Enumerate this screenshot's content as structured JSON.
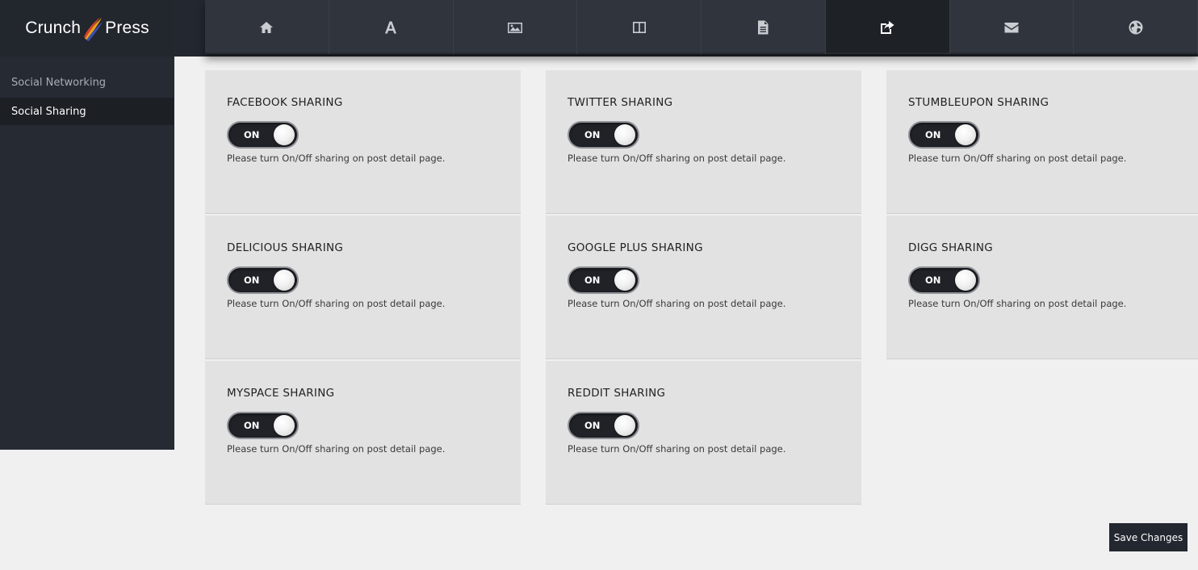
{
  "app": {
    "logo_left": "Crunch",
    "logo_right": "Press"
  },
  "nav": {
    "tabs": [
      {
        "icon": "home-icon",
        "active": false
      },
      {
        "icon": "typography-icon",
        "active": false
      },
      {
        "icon": "image-icon",
        "active": false
      },
      {
        "icon": "layout-columns-icon",
        "active": false
      },
      {
        "icon": "document-icon",
        "active": false
      },
      {
        "icon": "share-icon",
        "active": true
      },
      {
        "icon": "envelope-icon",
        "active": false
      },
      {
        "icon": "globe-icon",
        "active": false
      }
    ]
  },
  "sidebar": {
    "items": [
      {
        "label": "Social Networking",
        "active": false
      },
      {
        "label": "Social Sharing",
        "active": true
      }
    ]
  },
  "cards": [
    {
      "title": "FACEBOOK SHARING",
      "toggle": "ON",
      "description": "Please turn On/Off sharing on post detail page."
    },
    {
      "title": "TWITTER SHARING",
      "toggle": "ON",
      "description": "Please turn On/Off sharing on post detail page."
    },
    {
      "title": "STUMBLEUPON SHARING",
      "toggle": "ON",
      "description": "Please turn On/Off sharing on post detail page."
    },
    {
      "title": "DELICIOUS SHARING",
      "toggle": "ON",
      "description": "Please turn On/Off sharing on post detail page."
    },
    {
      "title": "GOOGLE PLUS SHARING",
      "toggle": "ON",
      "description": "Please turn On/Off sharing on post detail page."
    },
    {
      "title": "DIGG SHARING",
      "toggle": "ON",
      "description": "Please turn On/Off sharing on post detail page."
    },
    {
      "title": "MYSPACE SHARING",
      "toggle": "ON",
      "description": "Please turn On/Off sharing on post detail page."
    },
    {
      "title": "REDDIT SHARING",
      "toggle": "ON",
      "description": "Please turn On/Off sharing on post detail page."
    }
  ],
  "actions": {
    "save_label": "Save Changes"
  },
  "colors": {
    "topbar": "#23272f",
    "tab_bg": "#30343c",
    "tab_active": "#1e2125",
    "sidebar_bg": "#262a33",
    "card_bg": "#e2e2e2",
    "page_bg": "#f0f0f0"
  }
}
